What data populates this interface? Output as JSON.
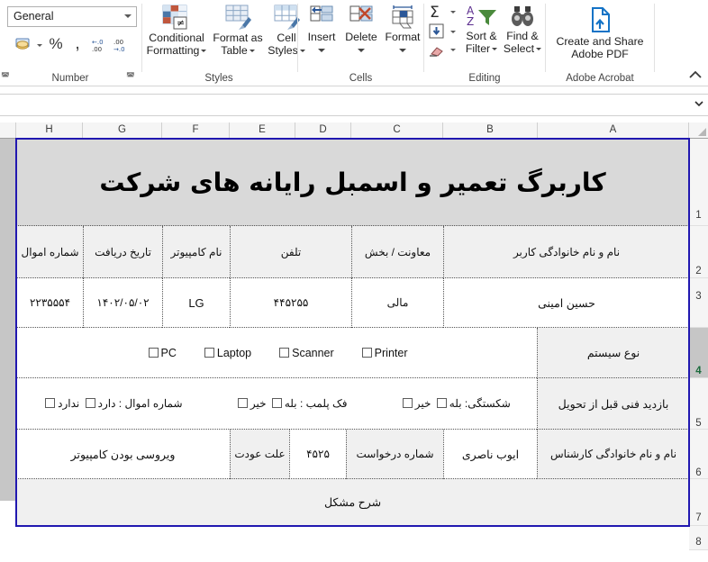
{
  "ribbon": {
    "number_group": {
      "label": "Number",
      "format_value": "General",
      "buttons": [
        "accounting-format",
        "percent-style",
        "comma-style",
        "decrease-decimal",
        "increase-decimal"
      ],
      "percent_glyph": "%",
      "comma_glyph": ",",
      "decrease_decimal_glyph": "←.0\n.00",
      "increase_decimal_glyph": ".00\n→.0"
    },
    "styles_group": {
      "label": "Styles",
      "items": [
        {
          "line1": "Conditional",
          "line2": "Formatting",
          "icon": "conditional-formatting-icon"
        },
        {
          "line1": "Format as",
          "line2": "Table",
          "icon": "format-as-table-icon"
        },
        {
          "line1": "Cell",
          "line2": "Styles",
          "icon": "cell-styles-icon"
        }
      ]
    },
    "cells_group": {
      "label": "Cells",
      "items": [
        {
          "line1": "Insert",
          "icon": "insert-cells-icon"
        },
        {
          "line1": "Delete",
          "icon": "delete-cells-icon"
        },
        {
          "line1": "Format",
          "icon": "format-cells-icon"
        }
      ]
    },
    "editing_group": {
      "label": "Editing",
      "items": [
        {
          "line1": "Sort &",
          "line2": "Filter",
          "icon": "sort-filter-icon"
        },
        {
          "line1": "Find &",
          "line2": "Select",
          "icon": "find-select-icon"
        }
      ],
      "mini_icons": [
        "autosum-icon",
        "fill-icon",
        "clear-icon"
      ]
    },
    "acrobat_group": {
      "label": "Adobe Acrobat",
      "button": {
        "line1": "Create and Share",
        "line2": "Adobe PDF",
        "icon": "adobe-pdf-icon"
      }
    },
    "collapse_icon": "chevron-up-icon"
  },
  "formula_bar": {
    "value": "",
    "dropdown_icon": "chevron-down-icon"
  },
  "sheet": {
    "columns": [
      "H",
      "G",
      "F",
      "E",
      "D",
      "C",
      "B",
      "A"
    ],
    "rows": [
      "1",
      "2",
      "3",
      "4",
      "5",
      "6",
      "7",
      "8"
    ],
    "selected_row": "4",
    "title": "کاربرگ تعمیر و اسمبل رایانه های شرکت",
    "header_row": {
      "user_name": "نام و نام خانوادگی کاربر",
      "department": "معاونت / بخش",
      "phone": "تلفن",
      "computer_name": "نام کامپیوتر",
      "receive_date": "تاریخ دریافت",
      "asset_number": "شماره اموال"
    },
    "value_row": {
      "user_name": "حسین امینی",
      "department": "مالی",
      "phone": "۴۴۵۲۵۵",
      "computer_name": "LG",
      "receive_date": "۱۴۰۲/۰۵/۰۲",
      "asset_number": "۲۲۳۵۵۵۴"
    },
    "system_type_row": {
      "label": "نوع سیستم",
      "options": [
        "Printer",
        "Scanner",
        "Laptop",
        "PC"
      ]
    },
    "inspection_row": {
      "label": "بازدید فنی قبل از تحویل",
      "asset_label": "شماره اموال :",
      "asset_yes": "دارد",
      "asset_no": "ندارد",
      "seal_label": "فک پلمب :",
      "seal_yes": "بله",
      "seal_no": "خیر",
      "broken_label": "شکستگی:",
      "broken_yes": "بله",
      "broken_no": "خیر"
    },
    "expert_row": {
      "expert_label": "نام و نام خانوادگی کارشناس",
      "expert_value": "ایوب ناصری",
      "request_label": "شماره درخواست",
      "request_value": "۴۵۲۵",
      "return_label": "علت عودت",
      "return_value": "ویروسی بودن کامپیوتر"
    },
    "problem_row": {
      "label": "شرح مشکل"
    }
  }
}
